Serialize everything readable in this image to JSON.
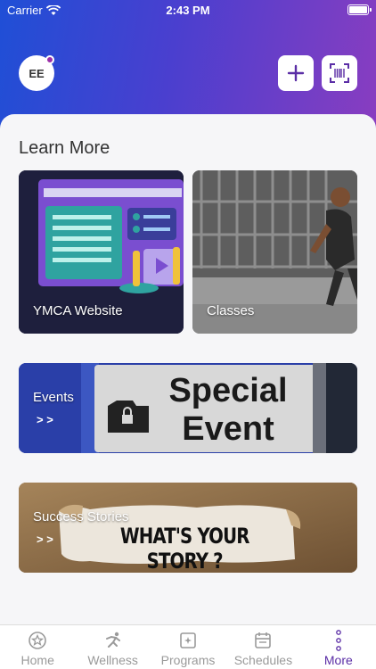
{
  "status_bar": {
    "carrier": "Carrier",
    "time": "2:43 PM"
  },
  "header": {
    "avatar_initials": "EE"
  },
  "section": {
    "title": "Learn More"
  },
  "cards": [
    {
      "label": "YMCA Website"
    },
    {
      "label": "Classes"
    },
    {
      "label": "Events",
      "arrow": "> >",
      "image_text": [
        "Special",
        "Event"
      ]
    },
    {
      "label": "Success Stories",
      "arrow": "> >",
      "image_text": "WHAT'S YOUR STORY ?"
    }
  ],
  "tabs": [
    {
      "label": "Home",
      "icon": "star-circle-icon"
    },
    {
      "label": "Wellness",
      "icon": "running-figure-icon"
    },
    {
      "label": "Programs",
      "icon": "programs-icon"
    },
    {
      "label": "Schedules",
      "icon": "calendar-icon"
    },
    {
      "label": "More",
      "icon": "vertical-dots-icon",
      "active": true
    }
  ],
  "colors": {
    "accent": "#5b2ea6",
    "header_start": "#1f4fd6",
    "header_end": "#8a3dc0"
  }
}
